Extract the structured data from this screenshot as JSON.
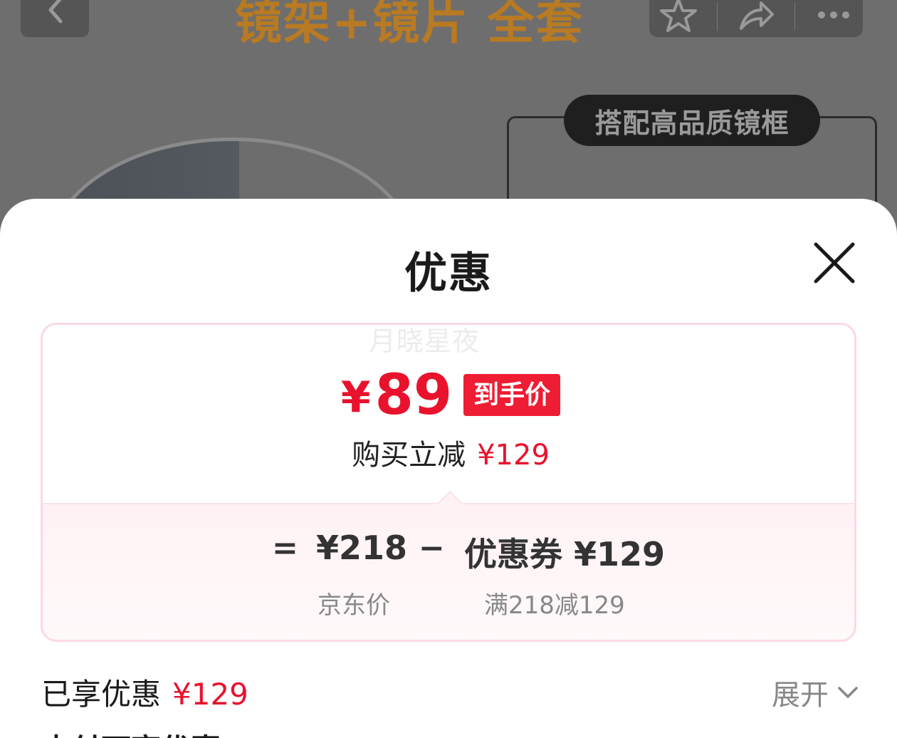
{
  "background": {
    "headline": "镜架+镜片 全套",
    "tag": "搭配高品质镜框"
  },
  "sheet": {
    "title": "优惠",
    "watermark": "月晓星夜",
    "final_price": {
      "currency": "¥",
      "value": "89",
      "badge": "到手价"
    },
    "discount_line": {
      "label": "购买立减",
      "amount": "¥129"
    },
    "calculation": {
      "equals": "=",
      "original_price": "¥218",
      "original_label": "京东价",
      "minus": "−",
      "coupon_value": "优惠券 ¥129",
      "coupon_label": "满218减129"
    },
    "enjoyed": {
      "label": "已享优惠",
      "amount": "¥129"
    },
    "expand_label": "展开",
    "next_section": "支付可享优惠"
  },
  "colors": {
    "accent": "#e9122d",
    "badge_bg": "#ee1d33",
    "card_border": "#fcd9e1"
  },
  "icons": [
    "back-icon",
    "star-icon",
    "share-icon",
    "more-icon",
    "close-icon",
    "chevron-down-icon"
  ]
}
